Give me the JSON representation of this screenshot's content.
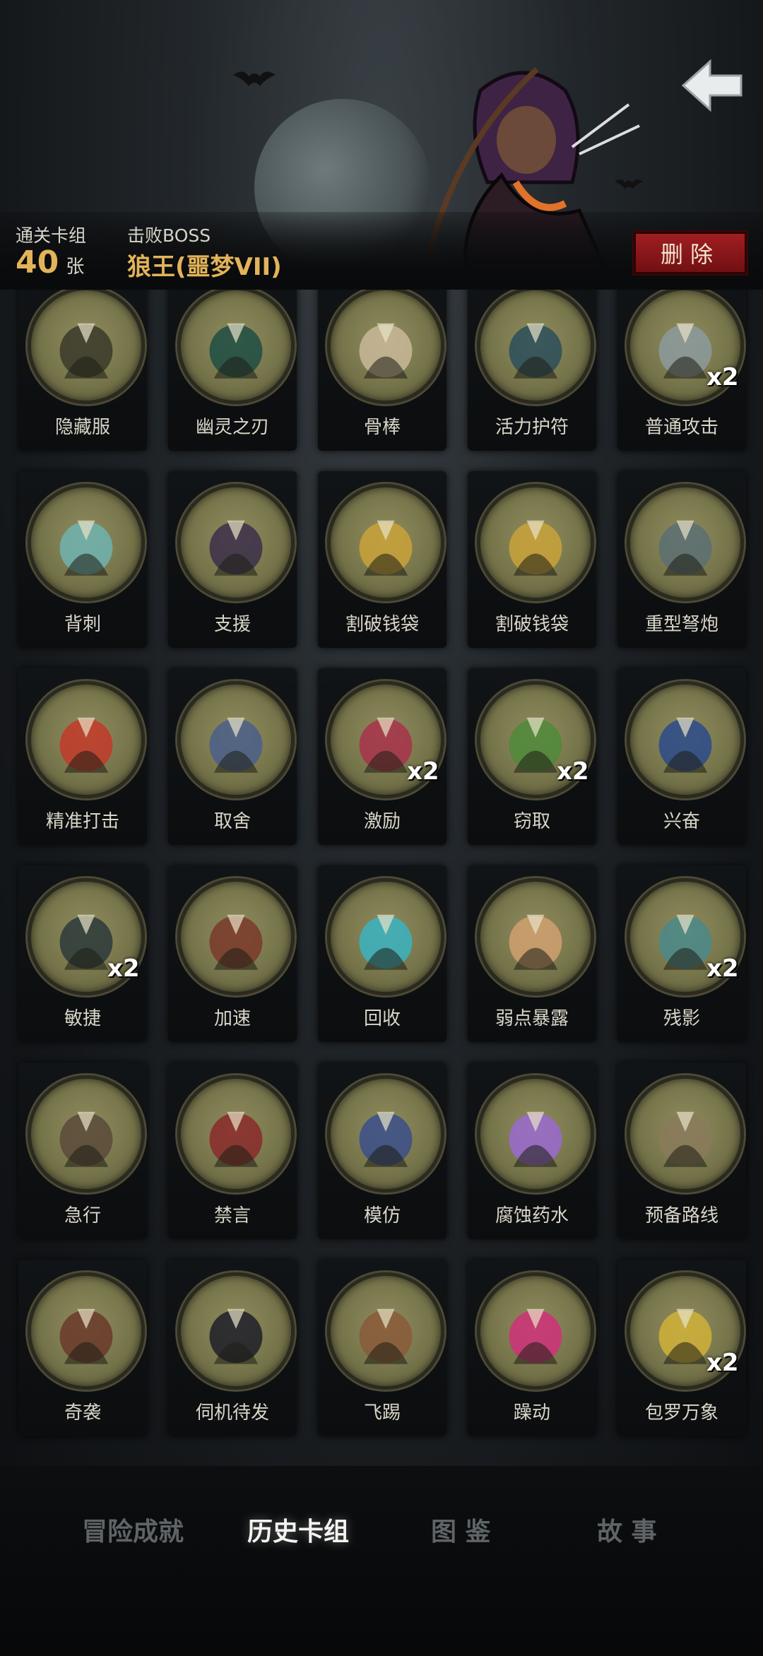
{
  "header": {
    "back_icon": "back-arrow-icon",
    "cleared_deck_label": "通关卡组",
    "card_count": "40",
    "card_unit": "张",
    "defeated_boss_label": "击败BOSS",
    "boss_name": "狼王(噩梦VII)",
    "delete_label": "删除",
    "colors": {
      "accent": "#e3b35a",
      "delete": "#a31f22"
    }
  },
  "cards": [
    {
      "label": "隐藏服",
      "count": "",
      "icon": "hooded-cloak-icon"
    },
    {
      "label": "幽灵之刃",
      "count": "",
      "icon": "ghost-blade-icon"
    },
    {
      "label": "骨棒",
      "count": "",
      "icon": "bone-club-icon"
    },
    {
      "label": "活力护符",
      "count": "",
      "icon": "vitality-amulet-icon"
    },
    {
      "label": "普通攻击",
      "count": "x2",
      "icon": "arrows-attack-icon"
    },
    {
      "label": "背刺",
      "count": "",
      "icon": "backstab-icon"
    },
    {
      "label": "支援",
      "count": "",
      "icon": "support-icon"
    },
    {
      "label": "割破钱袋",
      "count": "",
      "icon": "cut-purse-icon"
    },
    {
      "label": "割破钱袋",
      "count": "",
      "icon": "cut-purse-icon"
    },
    {
      "label": "重型弩炮",
      "count": "",
      "icon": "heavy-ballista-icon"
    },
    {
      "label": "精准打击",
      "count": "",
      "icon": "target-icon"
    },
    {
      "label": "取舍",
      "count": "",
      "icon": "sage-icon"
    },
    {
      "label": "激励",
      "count": "x2",
      "icon": "hammer-warrior-icon"
    },
    {
      "label": "窃取",
      "count": "x2",
      "icon": "goblin-chest-icon"
    },
    {
      "label": "兴奋",
      "count": "",
      "icon": "excited-dwarf-icon"
    },
    {
      "label": "敏捷",
      "count": "x2",
      "icon": "panther-icon"
    },
    {
      "label": "加速",
      "count": "",
      "icon": "witch-icon"
    },
    {
      "label": "回收",
      "count": "",
      "icon": "whirl-icon"
    },
    {
      "label": "弱点暴露",
      "count": "",
      "icon": "weak-point-icon"
    },
    {
      "label": "残影",
      "count": "x2",
      "icon": "afterimage-icon"
    },
    {
      "label": "急行",
      "count": "",
      "icon": "rush-icon"
    },
    {
      "label": "禁言",
      "count": "",
      "icon": "silence-icon"
    },
    {
      "label": "模仿",
      "count": "",
      "icon": "mimic-icon"
    },
    {
      "label": "腐蚀药水",
      "count": "",
      "icon": "potion-icon"
    },
    {
      "label": "预备路线",
      "count": "",
      "icon": "map-route-icon"
    },
    {
      "label": "奇袭",
      "count": "",
      "icon": "ambush-icon"
    },
    {
      "label": "伺机待发",
      "count": "",
      "icon": "ninja-icon"
    },
    {
      "label": "飞踢",
      "count": "",
      "icon": "flying-kick-icon"
    },
    {
      "label": "躁动",
      "count": "",
      "icon": "frenzy-icon"
    },
    {
      "label": "包罗万象",
      "count": "x2",
      "icon": "all-inclusive-icon"
    }
  ],
  "bottom_nav": {
    "tabs": [
      {
        "label": "冒险成就",
        "active": false
      },
      {
        "label": "历史卡组",
        "active": true
      },
      {
        "label": "图 鉴",
        "active": false
      },
      {
        "label": "故 事",
        "active": false
      }
    ]
  }
}
